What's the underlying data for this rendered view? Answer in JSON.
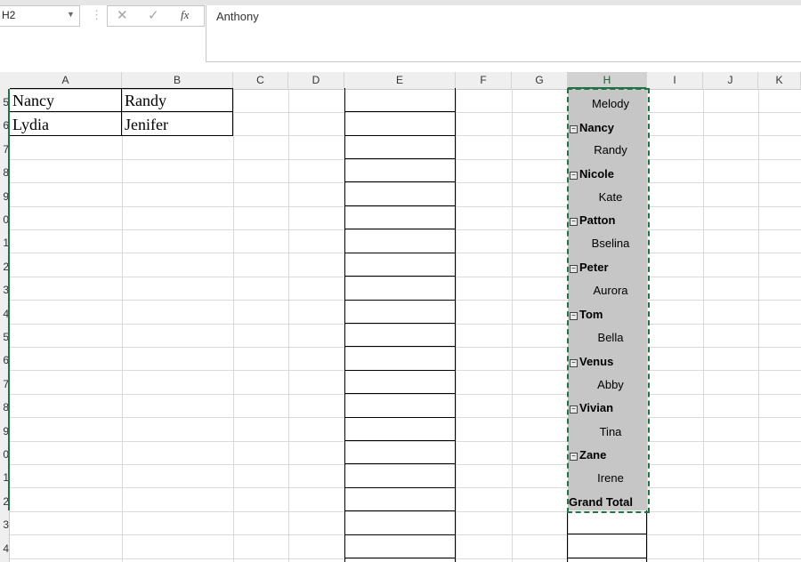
{
  "namebox": {
    "value": "H2"
  },
  "formula_bar": {
    "value": "Anthony",
    "fx_label": "fx"
  },
  "columns": [
    "A",
    "B",
    "C",
    "D",
    "E",
    "F",
    "G",
    "H",
    "I",
    "J",
    "K"
  ],
  "rows": [
    "5",
    "6",
    "7",
    "8",
    "9",
    "0",
    "1",
    "2",
    "3",
    "4",
    "5",
    "6",
    "7",
    "8",
    "9",
    "0",
    "1",
    "2",
    "3",
    "4"
  ],
  "table": [
    {
      "a": "Nancy",
      "b": "Randy"
    },
    {
      "a": "Lydia",
      "b": "Jenifer"
    }
  ],
  "pivot": [
    {
      "label": "Melody",
      "type": "child"
    },
    {
      "label": "Nancy",
      "type": "parent"
    },
    {
      "label": "Randy",
      "type": "child"
    },
    {
      "label": "Nicole",
      "type": "parent"
    },
    {
      "label": "Kate",
      "type": "child"
    },
    {
      "label": "Patton",
      "type": "parent"
    },
    {
      "label": "Bselina",
      "type": "child"
    },
    {
      "label": "Peter",
      "type": "parent"
    },
    {
      "label": "Aurora",
      "type": "child"
    },
    {
      "label": "Tom",
      "type": "parent"
    },
    {
      "label": "Bella",
      "type": "child"
    },
    {
      "label": "Venus",
      "type": "parent"
    },
    {
      "label": "Abby",
      "type": "child"
    },
    {
      "label": "Vivian",
      "type": "parent"
    },
    {
      "label": "Tina",
      "type": "child"
    },
    {
      "label": "Zane",
      "type": "parent"
    },
    {
      "label": "Irene",
      "type": "child"
    },
    {
      "label": "Grand Total",
      "type": "total"
    }
  ]
}
